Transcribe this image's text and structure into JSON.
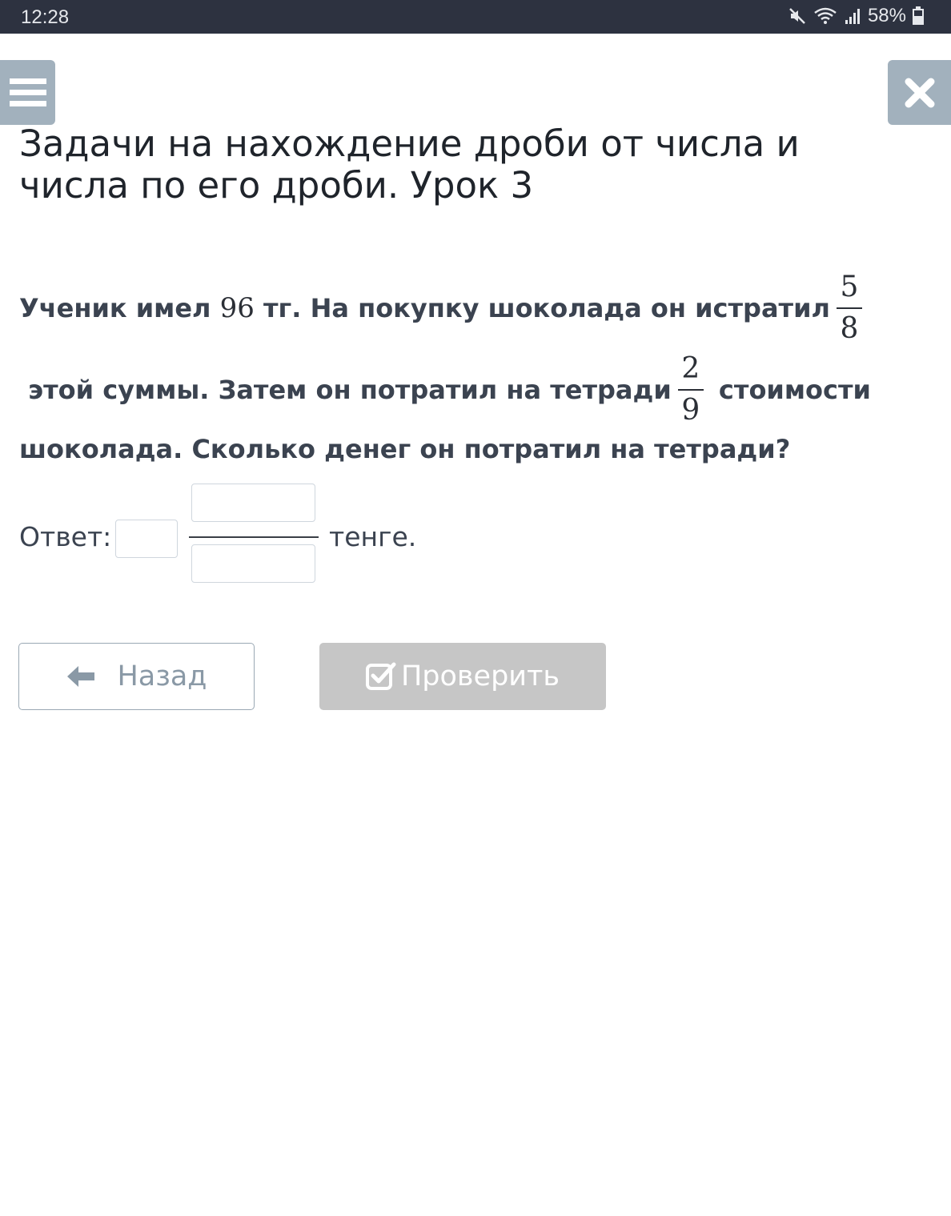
{
  "status_bar": {
    "time": "12:28",
    "battery": "58%"
  },
  "header": {
    "title": "Задачи на нахождение дроби от числа и числа по его дроби. Урок 3"
  },
  "task": {
    "line1_text": "Ученик имел ",
    "amount": "96",
    "line1_text2": " тг. На покупку шоколада он истратил",
    "frac1": {
      "num": "5",
      "den": "8"
    },
    "line2_text": " этой суммы. Затем он потратил на тетради",
    "frac2": {
      "num": "2",
      "den": "9"
    },
    "line2_text2": " стоимости",
    "line3_text": "шоколада. Сколько денег он потратил на тетради?"
  },
  "answer": {
    "label": "Ответ:",
    "suffix": "тенге.",
    "whole": "",
    "numerator": "",
    "denominator": ""
  },
  "buttons": {
    "back_label": "Назад",
    "check_label": "Проверить"
  },
  "icons": {
    "menu": "hamburger-menu-icon",
    "close": "close-icon",
    "back": "arrow-left-icon",
    "check": "checkbox-check-icon",
    "mute": "mute-icon",
    "wifi": "wifi-icon",
    "signal": "signal-icon",
    "battery": "battery-icon"
  },
  "colors": {
    "header_buttons": "#a2b1bd",
    "check_button": "#c6c6c6",
    "status_bar": "#2d3240"
  }
}
